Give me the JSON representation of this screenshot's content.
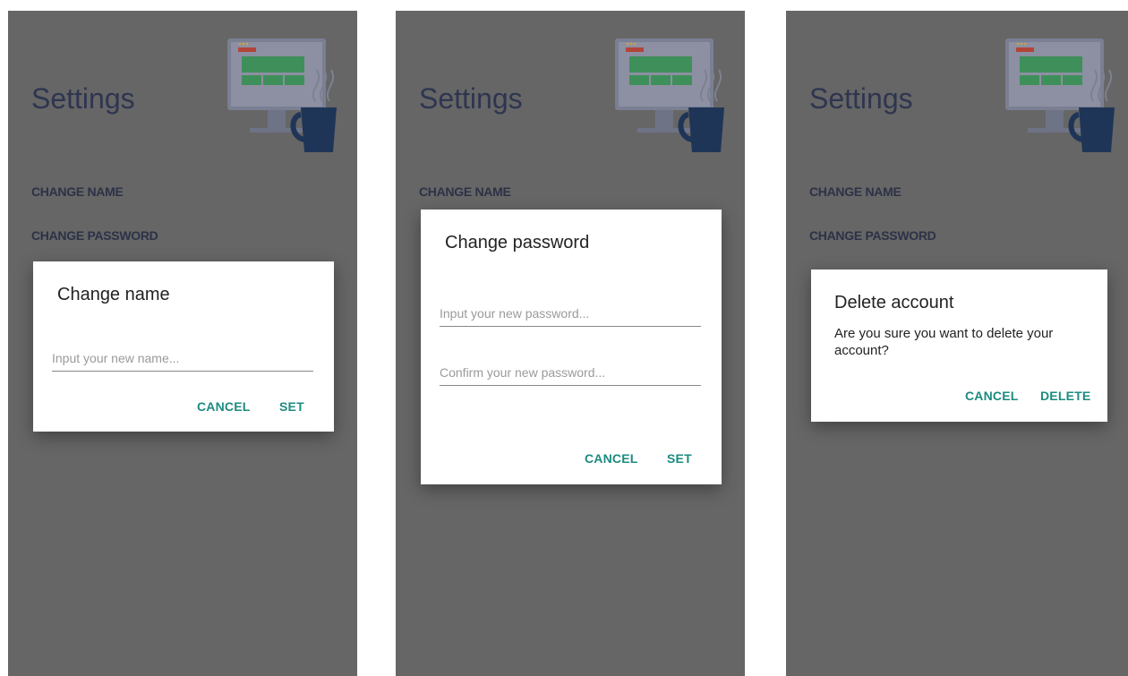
{
  "screens": [
    {
      "title": "Settings",
      "menu": [
        "CHANGE NAME",
        "CHANGE PASSWORD"
      ],
      "dialog": {
        "title": "Change name",
        "input_placeholder": "Input your new name...",
        "cancel_label": "CANCEL",
        "confirm_label": "SET"
      }
    },
    {
      "title": "Settings",
      "menu": [
        "CHANGE NAME"
      ],
      "dialog": {
        "title": "Change password",
        "input1_placeholder": "Input your new password...",
        "input2_placeholder": "Confirm your new password...",
        "cancel_label": "CANCEL",
        "confirm_label": "SET"
      }
    },
    {
      "title": "Settings",
      "menu": [
        "CHANGE NAME",
        "CHANGE PASSWORD"
      ],
      "dialog": {
        "title": "Delete account",
        "message": "Are you sure you want to delete your account?",
        "cancel_label": "CANCEL",
        "confirm_label": "DELETE"
      }
    }
  ],
  "colors": {
    "overlay": "#666666",
    "accent": "#1d8b80",
    "title_text": "#2e3550"
  },
  "icons": [
    "monitor-icon",
    "coffee-mug-icon"
  ]
}
